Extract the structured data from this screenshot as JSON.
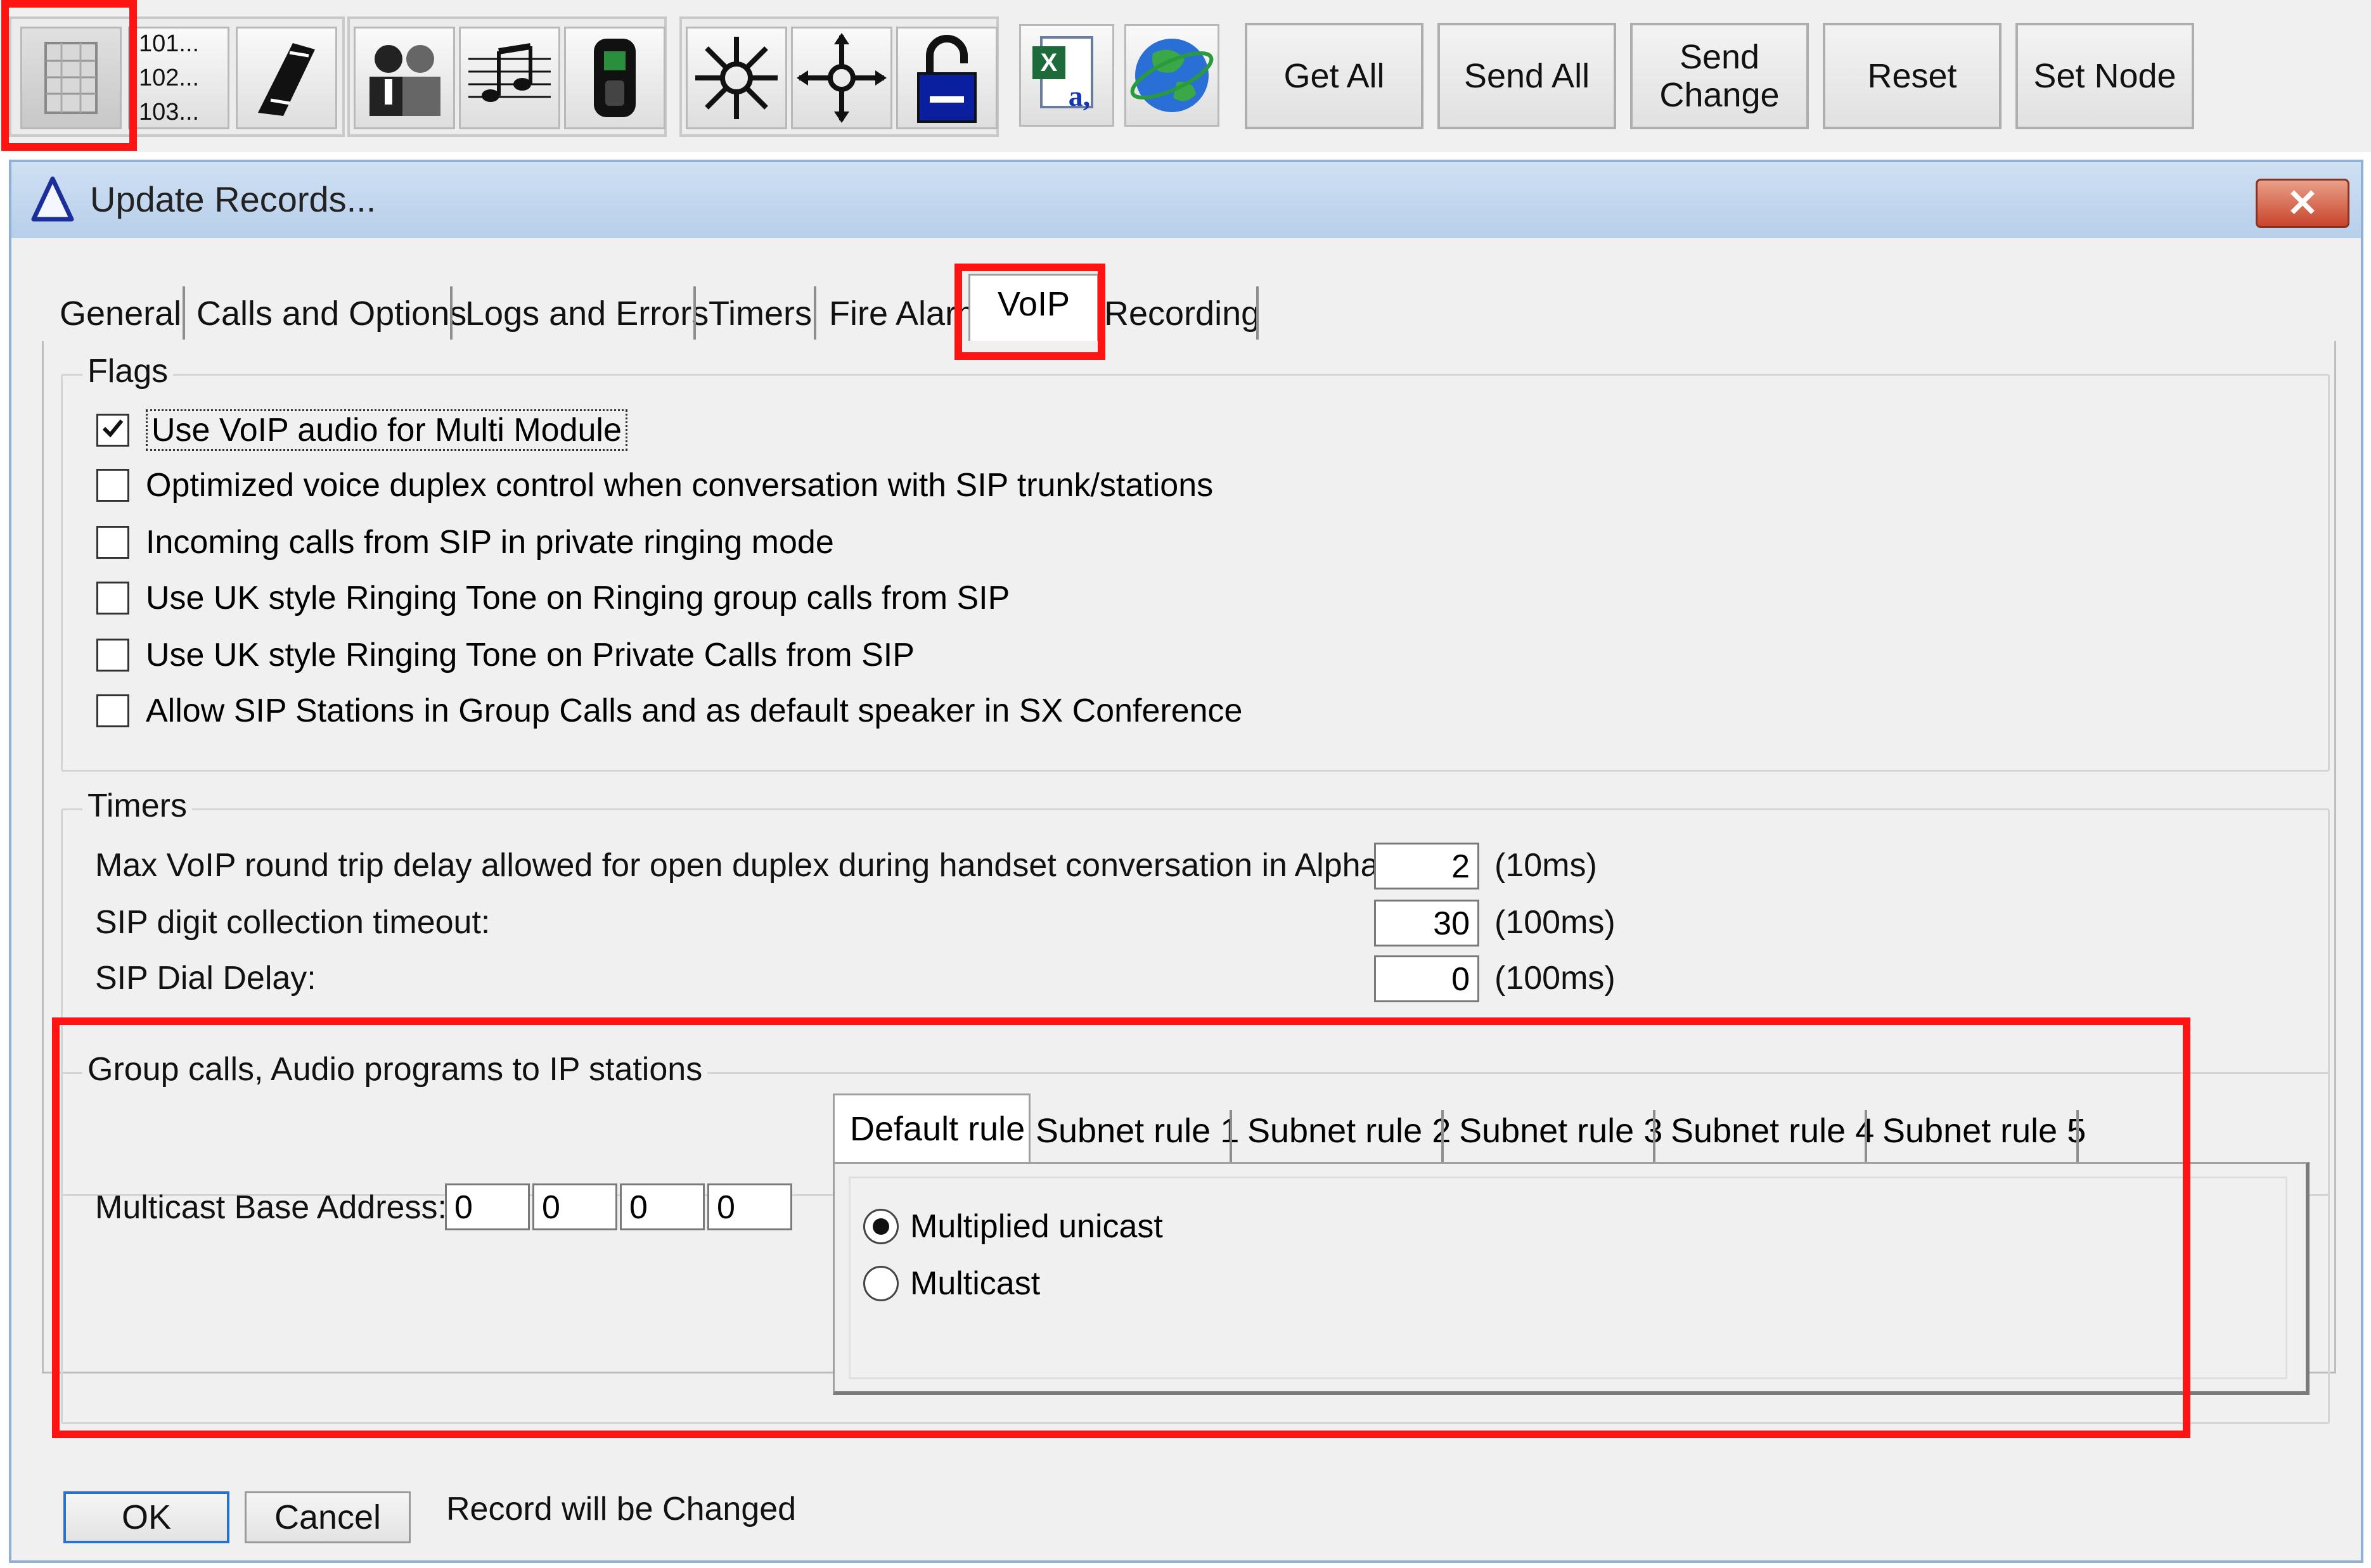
{
  "toolbar": {
    "number_list": [
      "101...",
      "102...",
      "103..."
    ],
    "buttons": {
      "get_all": "Get All",
      "send_all": "Send All",
      "send_change": "Send Change",
      "reset": "Reset",
      "set_node": "Set Node"
    },
    "icons": [
      "database-icon",
      "number-list-icon",
      "handset-icon",
      "users-icon",
      "music-icon",
      "intercom-station-icon",
      "network-star-icon",
      "move-cross-icon",
      "padlock-icon",
      "excel-address-icon",
      "globe-icon"
    ]
  },
  "dialog": {
    "title": "Update Records...",
    "close_label": "✕",
    "tabs": [
      "General",
      "Calls and Options",
      "Logs and Errors",
      "Timers",
      "Fire Alarm",
      "VoIP",
      "Recording"
    ],
    "active_tab": "VoIP",
    "flags": {
      "legend": "Flags",
      "items": [
        {
          "label": "Use VoIP audio for Multi Module",
          "checked": true
        },
        {
          "label": "Optimized voice duplex control when conversation with SIP trunk/stations",
          "checked": false
        },
        {
          "label": "Incoming calls from SIP in private ringing mode",
          "checked": false
        },
        {
          "label": "Use UK style Ringing Tone on Ringing group calls from SIP",
          "checked": false
        },
        {
          "label": "Use UK style Ringing Tone on Private Calls from SIP",
          "checked": false
        },
        {
          "label": "Allow SIP Stations in Group Calls and as default speaker in SX Conference",
          "checked": false
        }
      ]
    },
    "timers": {
      "legend": "Timers",
      "rows": [
        {
          "label": "Max VoIP round trip delay allowed for open duplex during handset conversation in AlphaNet:",
          "value": "2",
          "unit": "(10ms)"
        },
        {
          "label": "SIP digit collection timeout:",
          "value": "30",
          "unit": "(100ms)"
        },
        {
          "label": "SIP Dial Delay:",
          "value": "0",
          "unit": "(100ms)"
        }
      ]
    },
    "group_calls": {
      "legend": "Group calls, Audio programs to IP stations",
      "multicast_label": "Multicast Base Address:",
      "octets": [
        "0",
        "0",
        "0",
        "0"
      ],
      "rule_tabs": [
        "Default rule",
        "Subnet rule 1",
        "Subnet rule 2",
        "Subnet rule 3",
        "Subnet rule 4",
        "Subnet rule 5"
      ],
      "active_rule_tab": "Default rule",
      "modes": [
        {
          "label": "Multiplied unicast",
          "selected": true
        },
        {
          "label": "Multicast",
          "selected": false
        }
      ]
    },
    "footer": {
      "ok": "OK",
      "cancel": "Cancel",
      "status": "Record will be Changed"
    }
  },
  "colors": {
    "highlight": "#ff1414",
    "title_gradient_top": "#cfe0f3",
    "close_button": "#c8442c"
  }
}
